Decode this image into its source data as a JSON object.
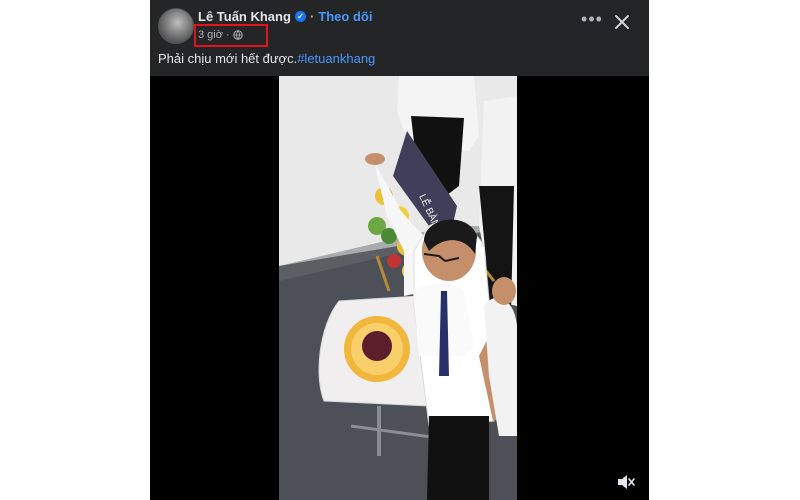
{
  "post": {
    "author": "Lê Tuấn Khang",
    "separator": "·",
    "follow_label": "Theo dõi",
    "time": "3 giờ",
    "time_separator": "·",
    "privacy_icon": "globe-icon",
    "more_icon": "more-options-icon",
    "close_icon": "close-icon",
    "caption_text": "Phải chịu mới hết được.",
    "hashtag": "#letuankhang",
    "mute_icon": "speaker-muted-icon",
    "sign_text": "LỄ BÀN GIAO"
  },
  "colors": {
    "card_bg": "#242526",
    "link": "#4599ff",
    "highlight": "#e0141b"
  }
}
